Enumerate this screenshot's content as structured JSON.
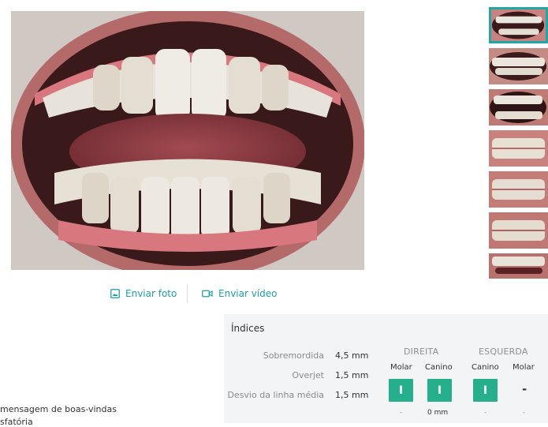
{
  "photo": {
    "main_label": "intraoral-front",
    "thumbnail_count": 7,
    "selected_thumbnail": 1
  },
  "actions": {
    "send_photo": "Enviar foto",
    "send_video": "Enviar vídeo"
  },
  "indices": {
    "title": "Índices",
    "metrics": [
      {
        "label": "Sobremordida",
        "value": "4,5 mm"
      },
      {
        "label": "Overjet",
        "value": "1,5 mm"
      },
      {
        "label": "Desvio da linha média",
        "value": "1,5 mm"
      }
    ],
    "right": {
      "title": "DIREITA",
      "molar": "Molar",
      "canino": "Canino",
      "molar_value": "I",
      "canino_value": "I",
      "molar_bottom": "-",
      "canino_bottom": "0 mm"
    },
    "left": {
      "title": "ESQUERDA",
      "canino": "Canino",
      "molar": "Molar",
      "canino_value": "I",
      "molar_value": "-",
      "canino_bottom": "-",
      "molar_bottom": "-"
    }
  },
  "left_text": {
    "line1": "mensagem de boas-vindas",
    "line2": "sfatória"
  },
  "colors": {
    "accent": "#1e9fa3",
    "tooth_green": "#25b08b",
    "panel_bg": "#f3f4f6"
  }
}
